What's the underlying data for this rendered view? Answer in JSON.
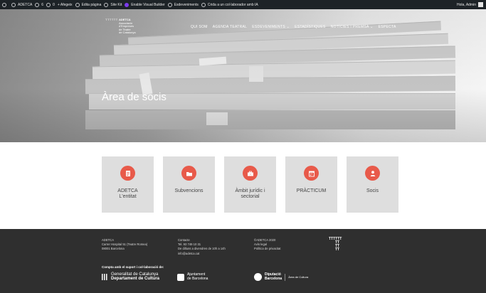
{
  "admin_bar": {
    "site": "ADETCA",
    "updates": "6",
    "comments": "0",
    "new": "+ Afegeix",
    "edit": "Edita pàgina",
    "site_kit": "Site Kit",
    "divi": "Enable Visual Builder",
    "events": "Esdeveniments",
    "ai": "Crida a un col·laborador amb IA",
    "greeting": "Hola, Admin"
  },
  "logo": {
    "mark": "TTTTTT",
    "lines": [
      "ADETCA",
      "Associació",
      "d'Empreses",
      "de Teatre",
      "de Catalunya"
    ]
  },
  "nav": [
    "QUI SOM",
    "AGENDA TEATRAL",
    "ESDEVENIMENTS ⌄",
    "ESTADÍSTIQUES",
    "NOTÍCIES I PREMSA ⌄",
    "ESPECTA"
  ],
  "hero_title": "Àrea de socis",
  "cards": [
    {
      "label": "ADETCA\nL'entitat",
      "icon": "document-icon"
    },
    {
      "label": "Subvencions",
      "icon": "folder-icon"
    },
    {
      "label": "Àmbit jurídic i\nsectorial",
      "icon": "briefcase-icon"
    },
    {
      "label": "PRÀCTICUM",
      "icon": "calendar-icon"
    },
    {
      "label": "Socis",
      "icon": "person-icon"
    }
  ],
  "footer": {
    "col1": [
      "ADETCA",
      "Carrer Hospital 51 (Teatre Romea)",
      "08001 Barcelona"
    ],
    "col2": [
      "Contacte",
      "Tel. 93 749 10 31",
      "De dilluns a divendres de 10h a 14h",
      "info@adetca.cat"
    ],
    "col3": [
      "©ADETCA 2020",
      "Avís legal",
      "Política de privacitat"
    ],
    "tmark": [
      "TTTTTT",
      "TT",
      "TT",
      "TT"
    ],
    "collab_label": "Compta amb el suport i col·laboració de:",
    "gencat": [
      "Generalitat de Catalunya",
      "Departament de Cultura"
    ],
    "ajuntament": [
      "Ajuntament",
      "de Barcelona"
    ],
    "diputacio": [
      "Diputació",
      "Barcelona",
      "Àrea de Cultura"
    ]
  },
  "colors": {
    "accent": "#e85a4a",
    "card_bg": "#dedede",
    "footer_bg": "#2f2f2f",
    "admin_bg": "#1d2327"
  }
}
